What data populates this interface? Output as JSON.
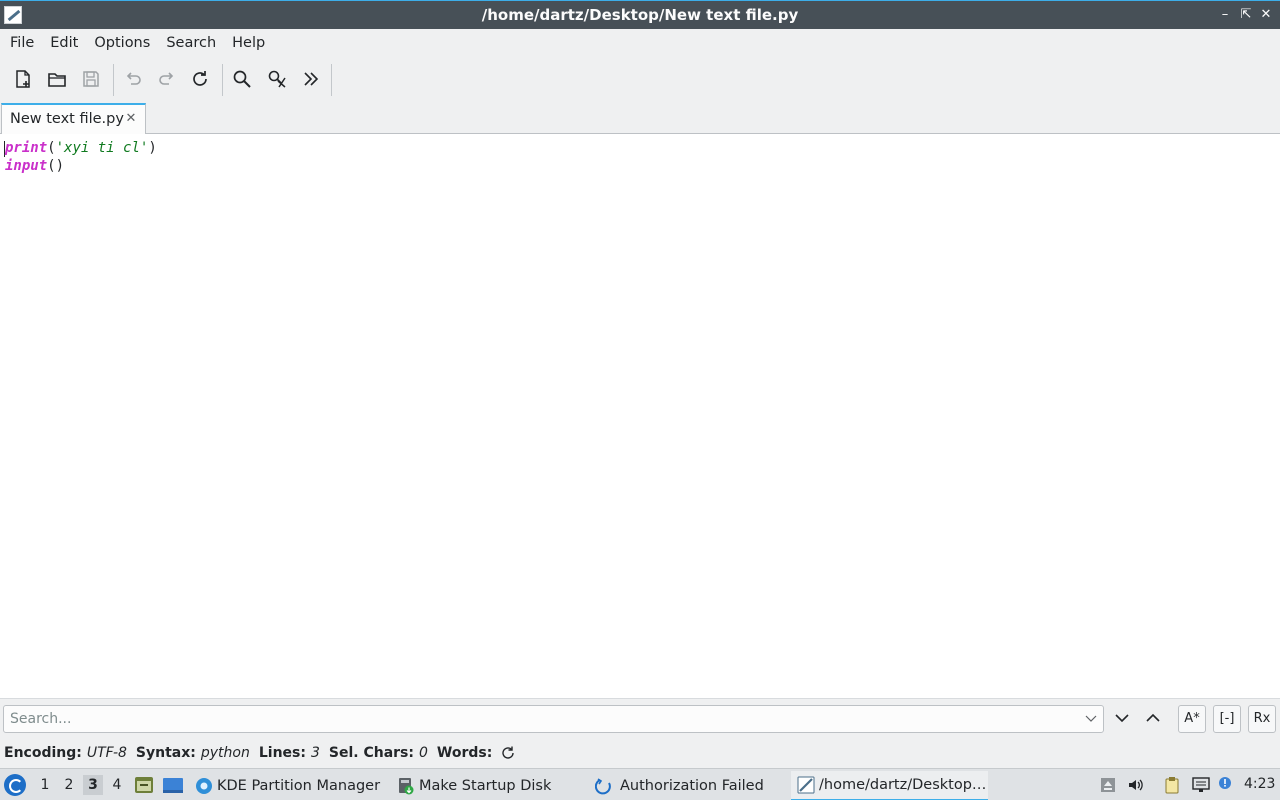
{
  "window": {
    "title": "/home/dartz/Desktop/New text file.py",
    "controls": [
      "minimize",
      "restore",
      "close"
    ]
  },
  "menubar": {
    "items": [
      "File",
      "Edit",
      "Options",
      "Search",
      "Help"
    ]
  },
  "toolbar": {
    "buttons": [
      "new-file-icon",
      "open-file-icon",
      "save-icon",
      "undo-icon",
      "redo-icon",
      "reload-icon",
      "find-icon",
      "find-replace-icon",
      "more-icon"
    ]
  },
  "tabs": [
    {
      "label": "New text file.py",
      "active": true
    }
  ],
  "editor": {
    "lines": [
      {
        "keyword": "print",
        "open": "(",
        "string": "'xyi ti cl'",
        "close": ")"
      },
      {
        "keyword": "input",
        "open": "(",
        "string": "",
        "close": ")"
      }
    ],
    "colors": {
      "keyword": "#ca30ca",
      "string": "#0f7a1f"
    }
  },
  "search": {
    "placeholder": "Search...",
    "options": [
      "A*",
      "[-]",
      "Rx"
    ]
  },
  "status": {
    "encoding_label": "Encoding:",
    "encoding_value": "UTF-8",
    "syntax_label": "Syntax:",
    "syntax_value": "python",
    "lines_label": "Lines:",
    "lines_value": "3",
    "selchars_label": "Sel. Chars:",
    "selchars_value": "0",
    "words_label": "Words:"
  },
  "taskbar": {
    "desktops": [
      "1",
      "2",
      "3",
      "4"
    ],
    "active_desktop": "3",
    "apps": [
      {
        "label": "KDE Partition Manager",
        "icon": "kde-partition-icon"
      },
      {
        "label": "Make Startup Disk",
        "icon": "startup-disk-icon"
      },
      {
        "label": "Authorization Failed",
        "icon": "authorization-icon"
      },
      {
        "label": "/home/dartz/Desktop…",
        "icon": "featherpad-icon",
        "active": true
      }
    ],
    "clock": "4:23"
  },
  "accent_color": "#3daee9"
}
